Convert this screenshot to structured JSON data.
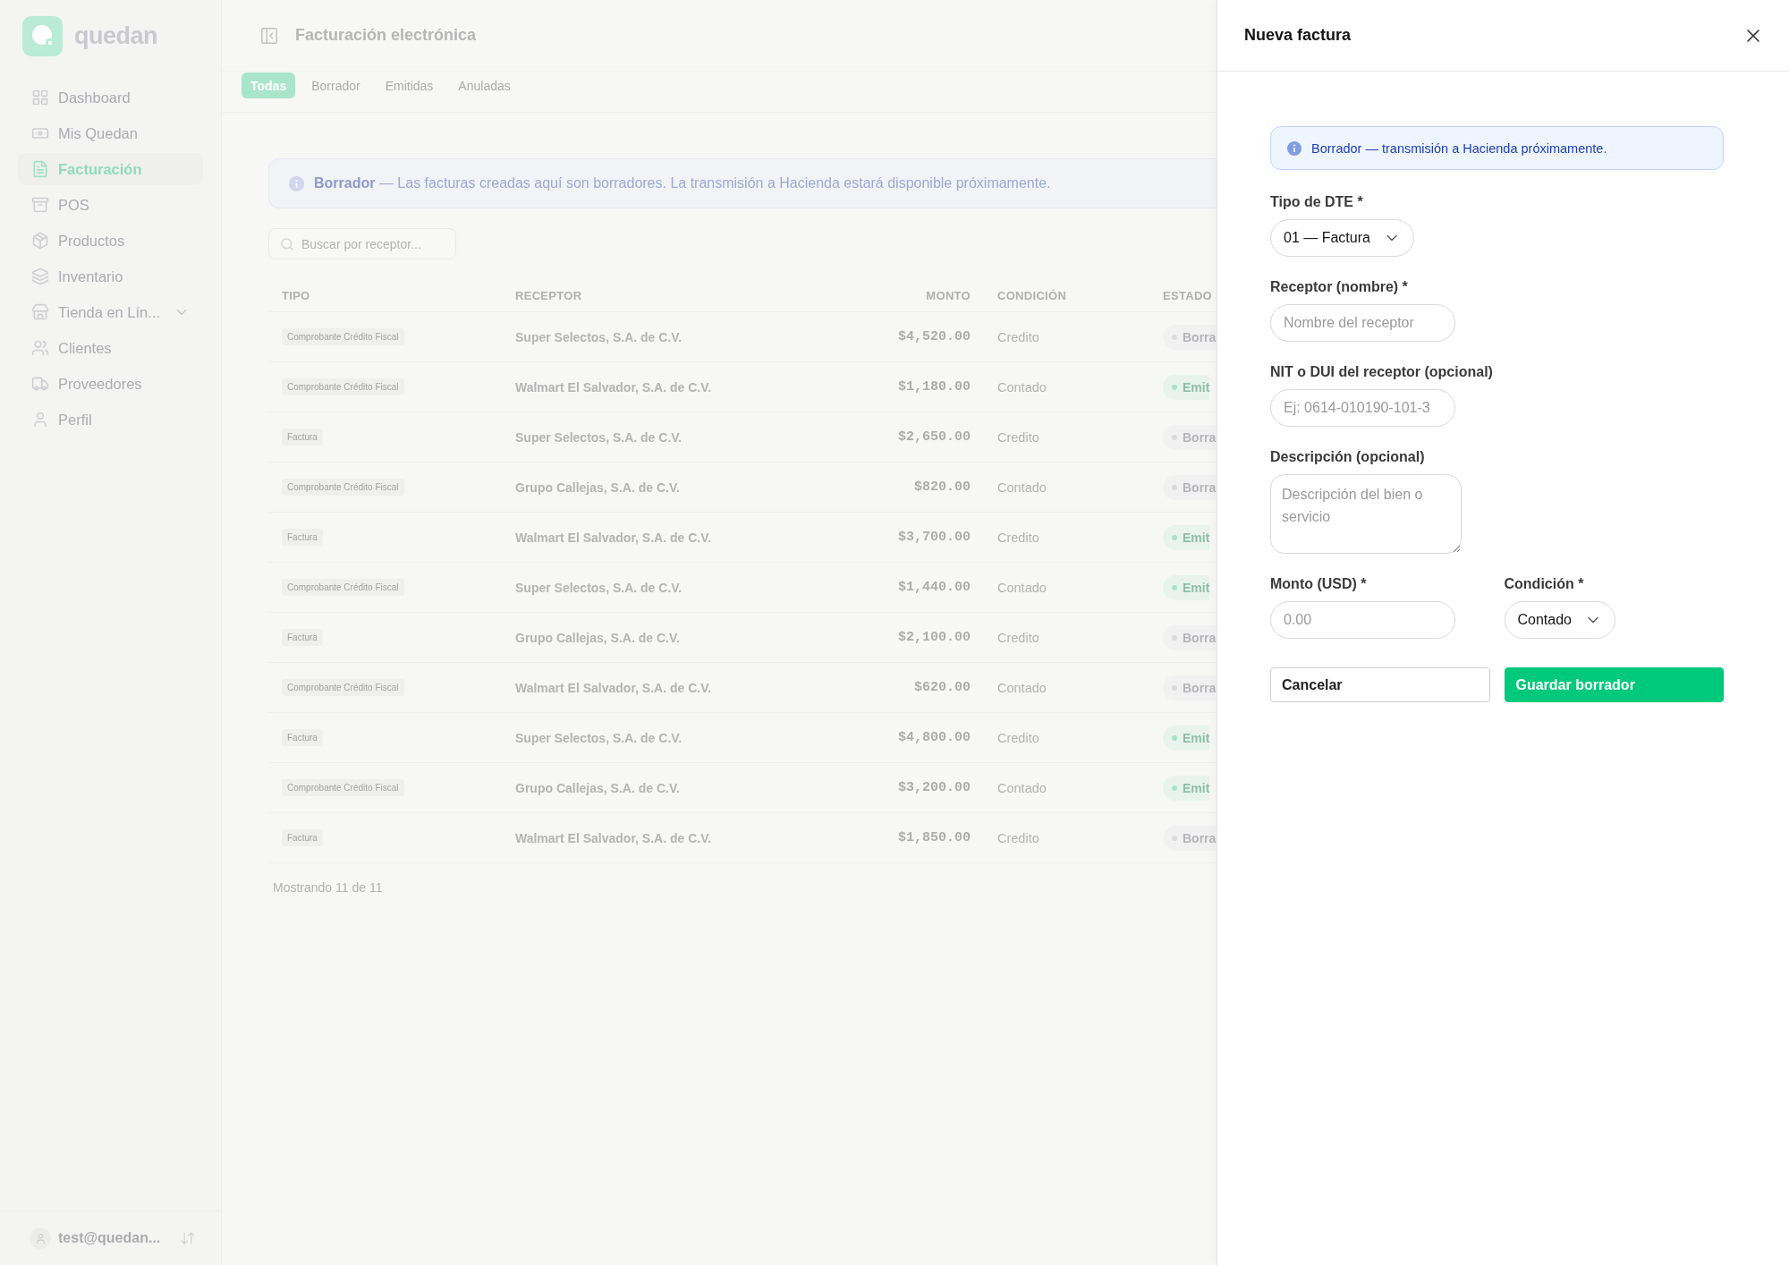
{
  "sidebar": {
    "logo": "quedan",
    "items": [
      {
        "label": "Dashboard",
        "selected": false,
        "expandable": false
      },
      {
        "label": "Mis Quedan",
        "selected": false,
        "expandable": false
      },
      {
        "label": "Facturación",
        "selected": true,
        "expandable": false
      },
      {
        "label": "POS",
        "selected": false,
        "expandable": false
      },
      {
        "label": "Productos",
        "selected": false,
        "expandable": false
      },
      {
        "label": "Inventario",
        "selected": false,
        "expandable": false
      },
      {
        "label": "Tienda en Lín...",
        "selected": false,
        "expandable": true
      },
      {
        "label": "Clientes",
        "selected": false,
        "expandable": false
      },
      {
        "label": "Proveedores",
        "selected": false,
        "expandable": false
      },
      {
        "label": "Perfil",
        "selected": false,
        "expandable": false
      }
    ],
    "user": "test@quedan..."
  },
  "main": {
    "title": "Facturación electrónica",
    "tabs": [
      {
        "label": "Todas",
        "selected": true
      },
      {
        "label": "Borrador",
        "selected": false
      },
      {
        "label": "Emitidas",
        "selected": false
      },
      {
        "label": "Anuladas",
        "selected": false
      }
    ],
    "banner": "**Borrador** — Las facturas creadas aquí son borradores. La transmisión a Hacienda estará disponible próximamente.",
    "search": {
      "placeholder": "Buscar por receptor..."
    },
    "table": {
      "columns": [
        "TIPO",
        "RECEPTOR",
        "MONTO",
        "CONDICIÓN",
        "ESTADO"
      ],
      "rows": [
        {
          "tipo": "Comprobante Crédito Fiscal",
          "receptor": "Super Selectos, S.A. de C.V.",
          "monto": "$4,520.00",
          "condicion": "Credito",
          "estado": {
            "label": "Borra",
            "color": "#d9d9de"
          }
        },
        {
          "tipo": "Comprobante Crédito Fiscal",
          "receptor": "Walmart El Salvador, S.A. de C.V.",
          "monto": "$1,180.00",
          "condicion": "Contado",
          "estado": {
            "label": "Emit",
            "color": "#a6e3c6"
          }
        },
        {
          "tipo": "Factura",
          "receptor": "Super Selectos, S.A. de C.V.",
          "monto": "$2,650.00",
          "condicion": "Credito",
          "estado": {
            "label": "Borra",
            "color": "#d9d9de"
          }
        },
        {
          "tipo": "Comprobante Crédito Fiscal",
          "receptor": "Grupo Callejas, S.A. de C.V.",
          "monto": "$820.00",
          "condicion": "Contado",
          "estado": {
            "label": "Borra",
            "color": "#d9d9de"
          }
        },
        {
          "tipo": "Factura",
          "receptor": "Walmart El Salvador, S.A. de C.V.",
          "monto": "$3,700.00",
          "condicion": "Credito",
          "estado": {
            "label": "Emit",
            "color": "#a6e3c6"
          }
        },
        {
          "tipo": "Comprobante Crédito Fiscal",
          "receptor": "Super Selectos, S.A. de C.V.",
          "monto": "$1,440.00",
          "condicion": "Contado",
          "estado": {
            "label": "Emit",
            "color": "#a6e3c6"
          }
        },
        {
          "tipo": "Factura",
          "receptor": "Grupo Callejas, S.A. de C.V.",
          "monto": "$2,100.00",
          "condicion": "Credito",
          "estado": {
            "label": "Borra",
            "color": "#d9d9de"
          }
        },
        {
          "tipo": "Comprobante Crédito Fiscal",
          "receptor": "Walmart El Salvador, S.A. de C.V.",
          "monto": "$620.00",
          "condicion": "Contado",
          "estado": {
            "label": "Borra",
            "color": "#d9d9de"
          }
        },
        {
          "tipo": "Factura",
          "receptor": "Super Selectos, S.A. de C.V.",
          "monto": "$4,800.00",
          "condicion": "Credito",
          "estado": {
            "label": "Emit",
            "color": "#a6e3c6"
          }
        },
        {
          "tipo": "Comprobante Crédito Fiscal",
          "receptor": "Grupo Callejas, S.A. de C.V.",
          "monto": "$3,200.00",
          "condicion": "Contado",
          "estado": {
            "label": "Emit",
            "color": "#a6e3c6"
          }
        },
        {
          "tipo": "Factura",
          "receptor": "Walmart El Salvador, S.A. de C.V.",
          "monto": "$1,850.00",
          "condicion": "Credito",
          "estado": {
            "label": "Borra",
            "color": "#d9d9de"
          }
        }
      ]
    },
    "footer": "Mostrando 11 de 11"
  },
  "panel": {
    "title": "Nueva factura",
    "notice": "Borrador — transmisión a Hacienda próximamente.",
    "fields": [
      {
        "kind": "select",
        "label": "Tipo de DTE *",
        "value": "01 — Factura"
      },
      {
        "kind": "input",
        "label": "Receptor (nombre) *",
        "placeholder": "Nombre del receptor"
      },
      {
        "kind": "input",
        "label": "NIT o DUI del receptor (opcional)",
        "placeholder": "Ej: 0614-010190-101-3"
      },
      {
        "kind": "textarea",
        "label": "Descripción (opcional)",
        "placeholder": "Descripción del bien o servicio"
      }
    ],
    "row_fields": [
      {
        "kind": "input",
        "label": "Monto (USD) *",
        "placeholder": "0.00"
      },
      {
        "kind": "select",
        "label": "Condición *",
        "value": "Contado"
      }
    ],
    "buttons": [
      {
        "label": "Cancelar",
        "kind": "secondary"
      },
      {
        "label": "Guardar borrador",
        "kind": "primary"
      }
    ]
  }
}
